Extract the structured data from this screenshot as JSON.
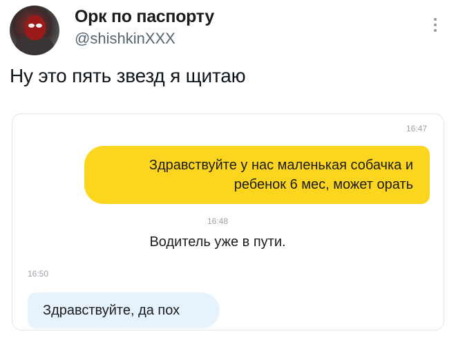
{
  "tweet": {
    "display_name": "Орк по паспорту",
    "handle": "@shishkinXXX",
    "text": "Ну это пять звезд я щитаю"
  },
  "chat": {
    "messages": [
      {
        "time": "16:47",
        "text_line1": "Здравствуйте у нас маленькая собачка и",
        "text_line2": "ребенок 6 мес, может орать",
        "direction": "outgoing"
      },
      {
        "time": "16:48",
        "text": "Водитель уже в пути.",
        "direction": "system"
      },
      {
        "time": "16:50",
        "text": "Здравствуйте, да пох",
        "direction": "incoming"
      }
    ]
  },
  "icons": {
    "more": "more-vertical-icon",
    "avatar": "deadpool-avatar"
  },
  "colors": {
    "outgoing_bubble": "#fcd51e",
    "incoming_bubble": "#e6f2fc",
    "handle": "#536471"
  }
}
